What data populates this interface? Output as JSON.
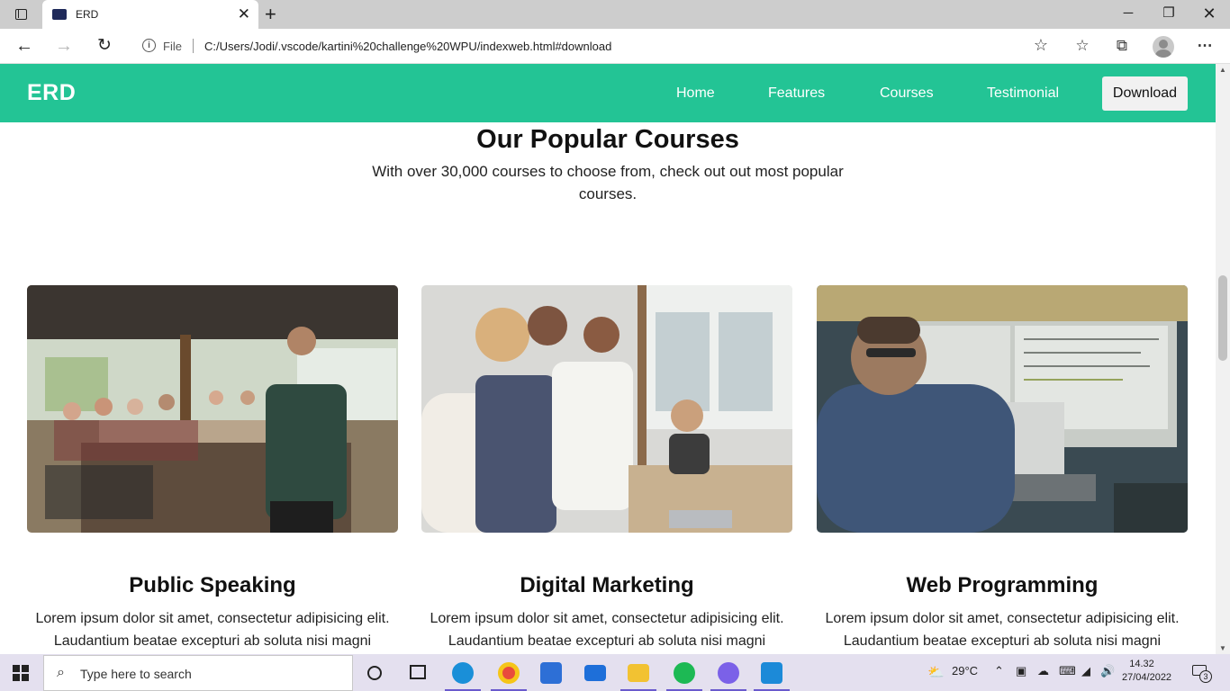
{
  "browser": {
    "tab_title": "ERD",
    "tab_close": "✕",
    "new_tab": "+",
    "address_scheme_label": "File",
    "url": "C:/Users/Jodi/.vscode/kartini%20challenge%20WPU/indexweb.html#download",
    "icons": [
      "back-icon",
      "forward-icon",
      "refresh-icon",
      "info-icon",
      "add-favorite-icon",
      "favorites-icon",
      "collections-icon",
      "profile-icon",
      "more-icon"
    ]
  },
  "site": {
    "logo": "ERD",
    "nav": {
      "home": "Home",
      "features": "Features",
      "courses": "Courses",
      "testimonial": "Testimonial",
      "download": "Download"
    },
    "accent_color": "#23c495",
    "section": {
      "title": "Our Popular Courses",
      "subtitle": "With over 30,000 courses to choose from, check out out most popular courses."
    },
    "courses": [
      {
        "title": "Public Speaking",
        "text": "Lorem ipsum dolor sit amet, consectetur adipisicing elit. Laudantium beatae excepturi ab soluta nisi magni"
      },
      {
        "title": "Digital Marketing",
        "text": "Lorem ipsum dolor sit amet, consectetur adipisicing elit. Laudantium beatae excepturi ab soluta nisi magni"
      },
      {
        "title": "Web Programming",
        "text": "Lorem ipsum dolor sit amet, consectetur adipisicing elit. Laudantium beatae excepturi ab soluta nisi magni"
      }
    ]
  },
  "taskbar": {
    "search_placeholder": "Type here to search",
    "weather": "29°C",
    "time": "14.32",
    "date": "27/04/2022",
    "notification_count": "3",
    "apps": [
      "edge",
      "chrome",
      "store",
      "mail",
      "file-explorer",
      "spotify",
      "discord",
      "vscode"
    ]
  }
}
